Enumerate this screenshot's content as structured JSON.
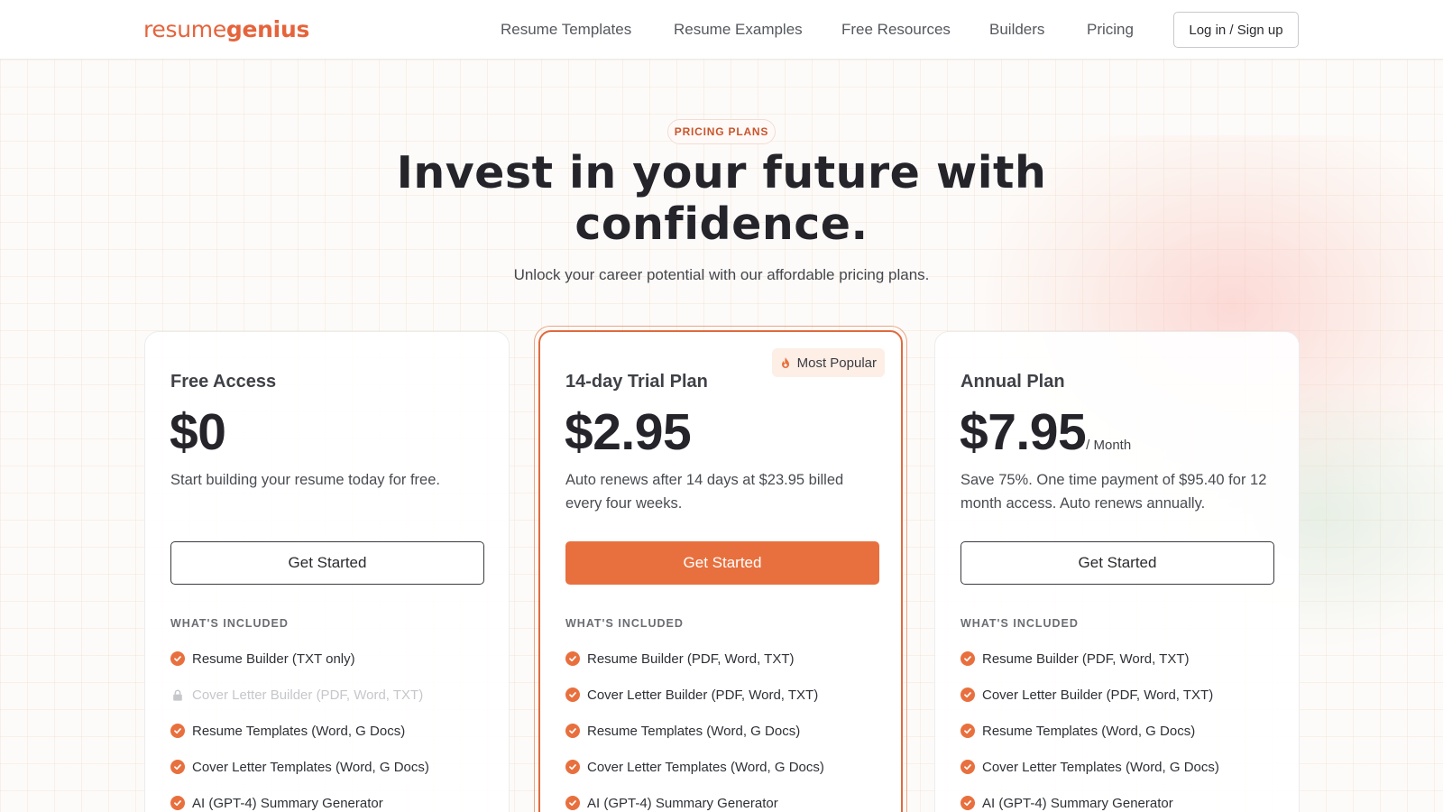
{
  "header": {
    "logo_part1": "resume",
    "logo_part2": "genius",
    "nav": [
      "Resume Templates",
      "Resume Examples",
      "Free Resources",
      "Builders",
      "Pricing"
    ],
    "login_label": "Log in / Sign up"
  },
  "hero": {
    "eyebrow": "PRICING PLANS",
    "title": "Invest in your future with confidence.",
    "subtitle": "Unlock your career potential with our affordable pricing plans."
  },
  "plans": [
    {
      "name": "Free Access",
      "price": "$0",
      "price_unit": "",
      "description": "Start building your resume today for free.",
      "cta": "Get Started",
      "included_label": "WHAT'S INCLUDED",
      "features": [
        {
          "label": "Resume Builder (TXT only)",
          "state": "included"
        },
        {
          "label": "Cover Letter Builder (PDF, Word, TXT)",
          "state": "locked"
        },
        {
          "label": "Resume Templates (Word, G Docs)",
          "state": "included"
        },
        {
          "label": "Cover Letter Templates (Word, G Docs)",
          "state": "included"
        },
        {
          "label": "AI (GPT-4) Summary Generator",
          "state": "included"
        }
      ]
    },
    {
      "name": "14-day Trial Plan",
      "price": "$2.95",
      "price_unit": "",
      "badge": "Most Popular",
      "description": "Auto renews after 14 days at $23.95 billed every four weeks.",
      "cta": "Get Started",
      "included_label": "WHAT'S INCLUDED",
      "features": [
        {
          "label": "Resume Builder (PDF, Word, TXT)",
          "state": "included"
        },
        {
          "label": "Cover Letter Builder (PDF, Word, TXT)",
          "state": "included"
        },
        {
          "label": "Resume Templates (Word, G Docs)",
          "state": "included"
        },
        {
          "label": "Cover Letter Templates (Word, G Docs)",
          "state": "included"
        },
        {
          "label": "AI (GPT-4) Summary Generator",
          "state": "included"
        }
      ]
    },
    {
      "name": "Annual Plan",
      "price": "$7.95",
      "price_unit": "/ Month",
      "description": "Save 75%. One time payment of $95.40 for 12 month access. Auto renews annually.",
      "cta": "Get Started",
      "included_label": "WHAT'S INCLUDED",
      "features": [
        {
          "label": "Resume Builder (PDF, Word, TXT)",
          "state": "included"
        },
        {
          "label": "Cover Letter Builder (PDF, Word, TXT)",
          "state": "included"
        },
        {
          "label": "Resume Templates (Word, G Docs)",
          "state": "included"
        },
        {
          "label": "Cover Letter Templates (Word, G Docs)",
          "state": "included"
        },
        {
          "label": "AI (GPT-4) Summary Generator",
          "state": "included"
        }
      ]
    }
  ],
  "icons": {
    "included": "check-circle-icon",
    "locked": "lock-icon",
    "badge": "fire-icon"
  },
  "colors": {
    "brand": "#e5643c",
    "primary_button": "#e8703e",
    "badge_bg": "#fdeee6"
  }
}
